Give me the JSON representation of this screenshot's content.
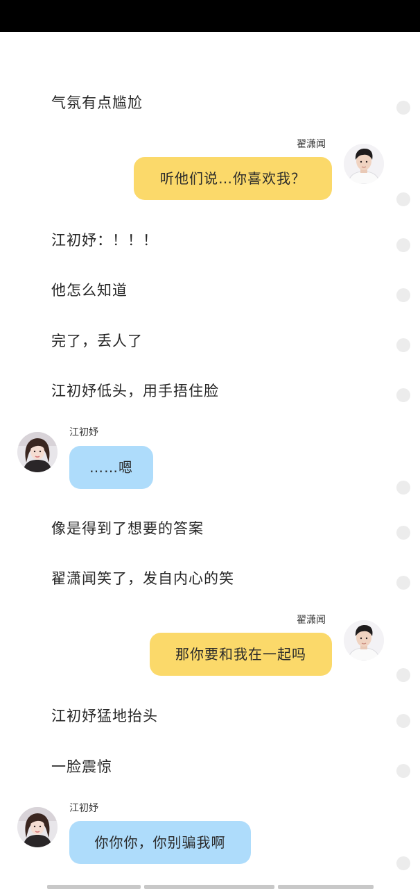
{
  "colors": {
    "status_bar": "#000000",
    "right_bubble": "#fbd96a",
    "left_bubble": "#aedcfb",
    "side_dot": "#ececec"
  },
  "messages": {
    "n1": "气氛有点尴尬",
    "m1": {
      "speaker": "翟潇闻",
      "text": "听他们说…你喜欢我？",
      "avatar": "boy-avatar"
    },
    "n2": "江初妤：！！！",
    "n3": "他怎么知道",
    "n4": "完了，丢人了",
    "n5": "江初妤低头，用手捂住脸",
    "m2": {
      "speaker": "江初妤",
      "text": "……嗯",
      "avatar": "girl-avatar"
    },
    "n6": "像是得到了想要的答案",
    "n7": "翟潇闻笑了，发自内心的笑",
    "m3": {
      "speaker": "翟潇闻",
      "text": "那你要和我在一起吗",
      "avatar": "boy-avatar"
    },
    "n8": "江初妤猛地抬头",
    "n9": "一脸震惊",
    "m4": {
      "speaker": "江初妤",
      "text": "你你你，你别骗我啊",
      "avatar": "girl-avatar"
    }
  }
}
